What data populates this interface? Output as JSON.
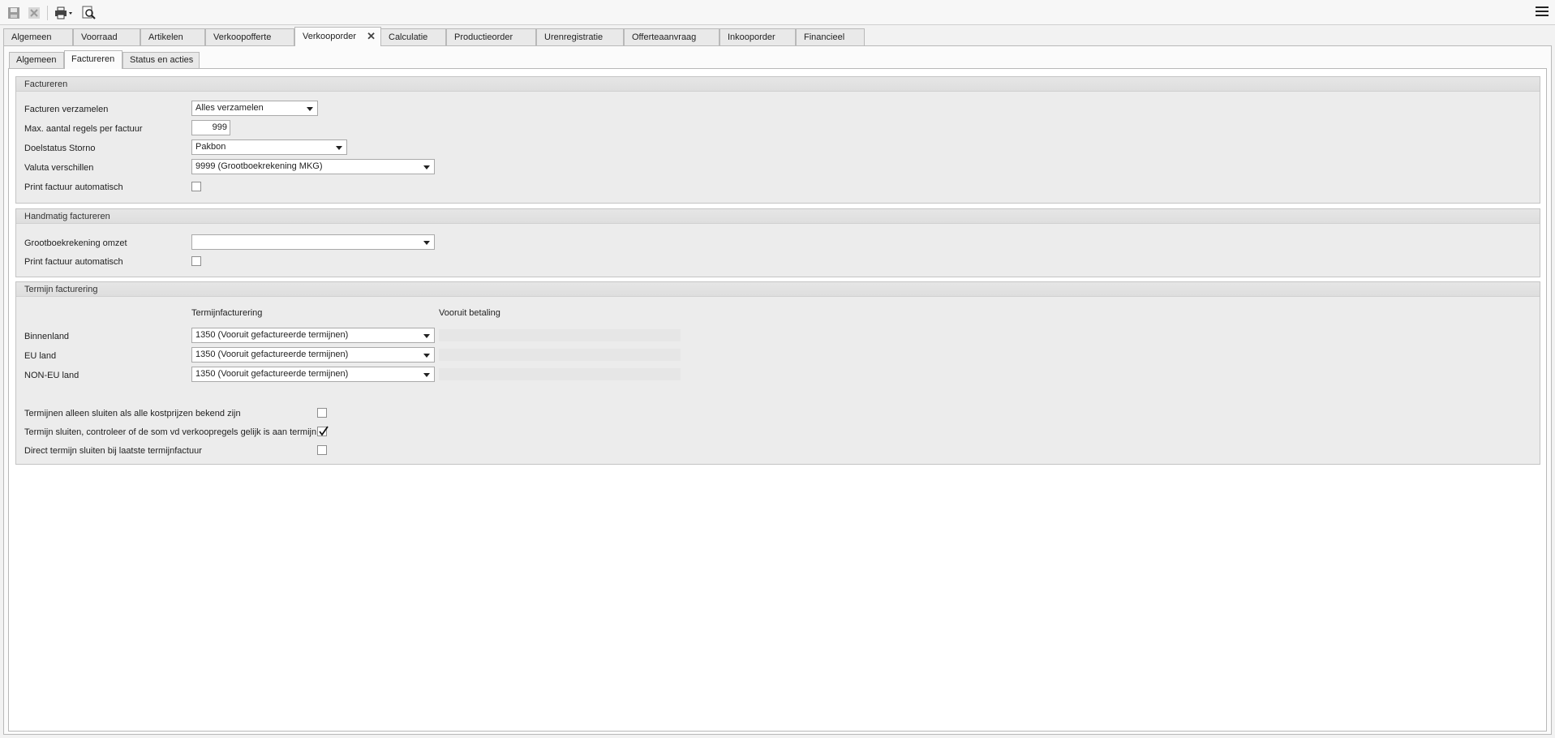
{
  "toolbar": {
    "icons": [
      "save-icon",
      "cancel-icon",
      "print-icon",
      "print-preview-icon",
      "hamburger-menu-icon"
    ]
  },
  "tabs": [
    {
      "label": "Algemeen"
    },
    {
      "label": "Voorraad"
    },
    {
      "label": "Artikelen"
    },
    {
      "label": "Verkoopofferte"
    },
    {
      "label": "Verkooporder",
      "active": true
    },
    {
      "label": "Calculatie"
    },
    {
      "label": "Productieorder"
    },
    {
      "label": "Urenregistratie"
    },
    {
      "label": "Offerteaanvraag"
    },
    {
      "label": "Inkooporder"
    },
    {
      "label": "Financieel"
    }
  ],
  "subtabs": [
    {
      "label": "Algemeen"
    },
    {
      "label": "Factureren",
      "active": true
    },
    {
      "label": "Status en acties"
    }
  ],
  "factureren": {
    "title": "Factureren",
    "facturen_verzamelen_label": "Facturen verzamelen",
    "facturen_verzamelen_value": "Alles verzamelen",
    "max_regels_label": "Max. aantal regels per factuur",
    "max_regels_value": "999",
    "doelstatus_label": "Doelstatus Storno",
    "doelstatus_value": "Pakbon",
    "valuta_label": "Valuta verschillen",
    "valuta_value": "9999 (Grootboekrekening MKG)",
    "print_label": "Print factuur automatisch",
    "print_checked": false
  },
  "handmatig": {
    "title": "Handmatig factureren",
    "grootboek_label": "Grootboekrekening omzet",
    "grootboek_value": "",
    "print_label": "Print factuur automatisch",
    "print_checked": false
  },
  "termijn": {
    "title": "Termijn facturering",
    "col_termijn": "Termijnfacturering",
    "col_vooruit": "Vooruit betaling",
    "rows": [
      {
        "label": "Binnenland",
        "value": "1350 (Vooruit gefactureerde termijnen)"
      },
      {
        "label": "EU land",
        "value": "1350 (Vooruit gefactureerde termijnen)"
      },
      {
        "label": "NON-EU land",
        "value": "1350 (Vooruit gefactureerde termijnen)"
      }
    ],
    "options": [
      {
        "label": "Termijnen alleen sluiten als alle kostprijzen bekend zijn",
        "checked": false
      },
      {
        "label": "Termijn sluiten, controleer of de som vd verkoopregels gelijk is aan termijn",
        "checked": true
      },
      {
        "label": "Direct termijn sluiten bij laatste termijnfactuur",
        "checked": false
      }
    ]
  }
}
